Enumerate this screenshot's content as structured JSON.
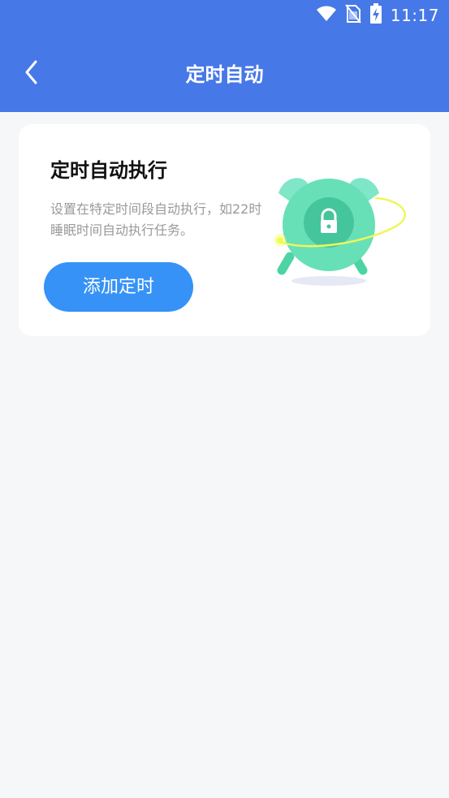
{
  "status_bar": {
    "time": "11:17",
    "icons": [
      "wifi-icon",
      "no-sim-icon",
      "battery-charging-icon"
    ]
  },
  "nav": {
    "title": "定时自动",
    "back_icon": "chevron-left-icon"
  },
  "card": {
    "title": "定时自动执行",
    "description_line1": "设置在特定时间段自动执行，如22时",
    "description_line2": "睡眠时间自动执行任务。",
    "button_label": "添加定时",
    "illustration": "alarm-clock-lock-icon"
  },
  "colors": {
    "header": "#4778e8",
    "button": "#3692f6",
    "background": "#f6f7f9",
    "clock": "#5ddcb0"
  }
}
